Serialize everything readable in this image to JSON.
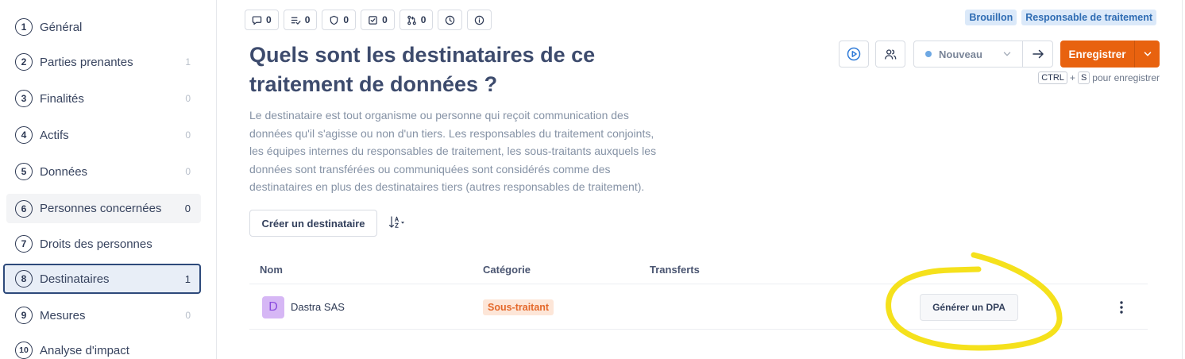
{
  "sidebar": {
    "items": [
      {
        "num": "1",
        "label": "Général"
      },
      {
        "num": "2",
        "label": "Parties prenantes",
        "count": "1"
      },
      {
        "num": "3",
        "label": "Finalités",
        "count": "0"
      },
      {
        "num": "4",
        "label": "Actifs",
        "count": "0"
      },
      {
        "num": "5",
        "label": "Données",
        "count": "0"
      },
      {
        "num": "6",
        "label": "Personnes concernées",
        "count": "0",
        "highlighted": true
      },
      {
        "num": "7",
        "label": "Droits des personnes"
      },
      {
        "num": "8",
        "label": "Destinataires",
        "count": "1",
        "selected": true
      },
      {
        "num": "9",
        "label": "Mesures",
        "count": "0"
      },
      {
        "num": "10",
        "label": "Analyse d'impact"
      }
    ]
  },
  "toolbar": {
    "chips": [
      {
        "icon": "comment-icon",
        "count": "0"
      },
      {
        "icon": "list-check-icon",
        "count": "0"
      },
      {
        "icon": "shield-icon",
        "count": "0"
      },
      {
        "icon": "checkbox-icon",
        "count": "0"
      },
      {
        "icon": "git-pull-request-icon",
        "count": "0"
      },
      {
        "icon": "clock-icon"
      },
      {
        "icon": "info-icon"
      }
    ]
  },
  "badges": [
    {
      "label": "Brouillon"
    },
    {
      "label": "Responsable de traitement"
    }
  ],
  "header": {
    "title_lines": [
      "Quels sont les destinataires de ce",
      "traitement de données ?"
    ],
    "description_lines": [
      "Le destinataire est tout organisme ou personne qui reçoit communication des",
      "données qu'il s'agisse ou non d'un tiers. Les responsables du traitement conjoints,",
      "les équipes internes du responsables de traitement, les sous-traitants auxquels les",
      "données sont transférées ou communiquées sont considérés comme des",
      "destinataires en plus des destinataires tiers (autres responsables de traitement)."
    ]
  },
  "controls": {
    "play_icon": "play-circle-icon",
    "users_icon": "users-icon",
    "status": {
      "value": "Nouveau",
      "icon": "chevron-down-icon"
    },
    "next_icon": "arrow-right-icon",
    "save": {
      "label": "Enregistrer",
      "dropdown_icon": "chevron-down-icon"
    },
    "shortcut": {
      "keys": [
        "CTRL",
        "S"
      ],
      "joiner": "+",
      "text": "pour enregistrer"
    }
  },
  "actions": {
    "create_label": "Créer un destinataire",
    "sort_icon": "sort-alpha-down-icon"
  },
  "table": {
    "columns": [
      "Nom",
      "Catégorie",
      "Transferts"
    ],
    "rows": [
      {
        "avatar": "D",
        "name": "Dastra SAS",
        "category": "Sous-traitant",
        "action_label": "Générer un DPA",
        "menu_icon": "more-vertical-icon"
      }
    ]
  },
  "colors": {
    "accent": "#e8620f",
    "primary_blue": "#2f7bd8",
    "text_dark": "#2c3853",
    "title": "#3d4b6d",
    "muted": "#8592a5",
    "badge_bg": "#dbe9f9",
    "badge_text": "#2e6cb3",
    "selected_border": "#2e4a7b",
    "selected_bg": "#e8eef7",
    "status_dot": "#6ea8e3",
    "avatar_bg": "#d6b7f5",
    "avatar_text": "#8a4bde",
    "category_bg": "#fde6d8",
    "category_text": "#e4692b",
    "annotation": "#f5e11c"
  }
}
